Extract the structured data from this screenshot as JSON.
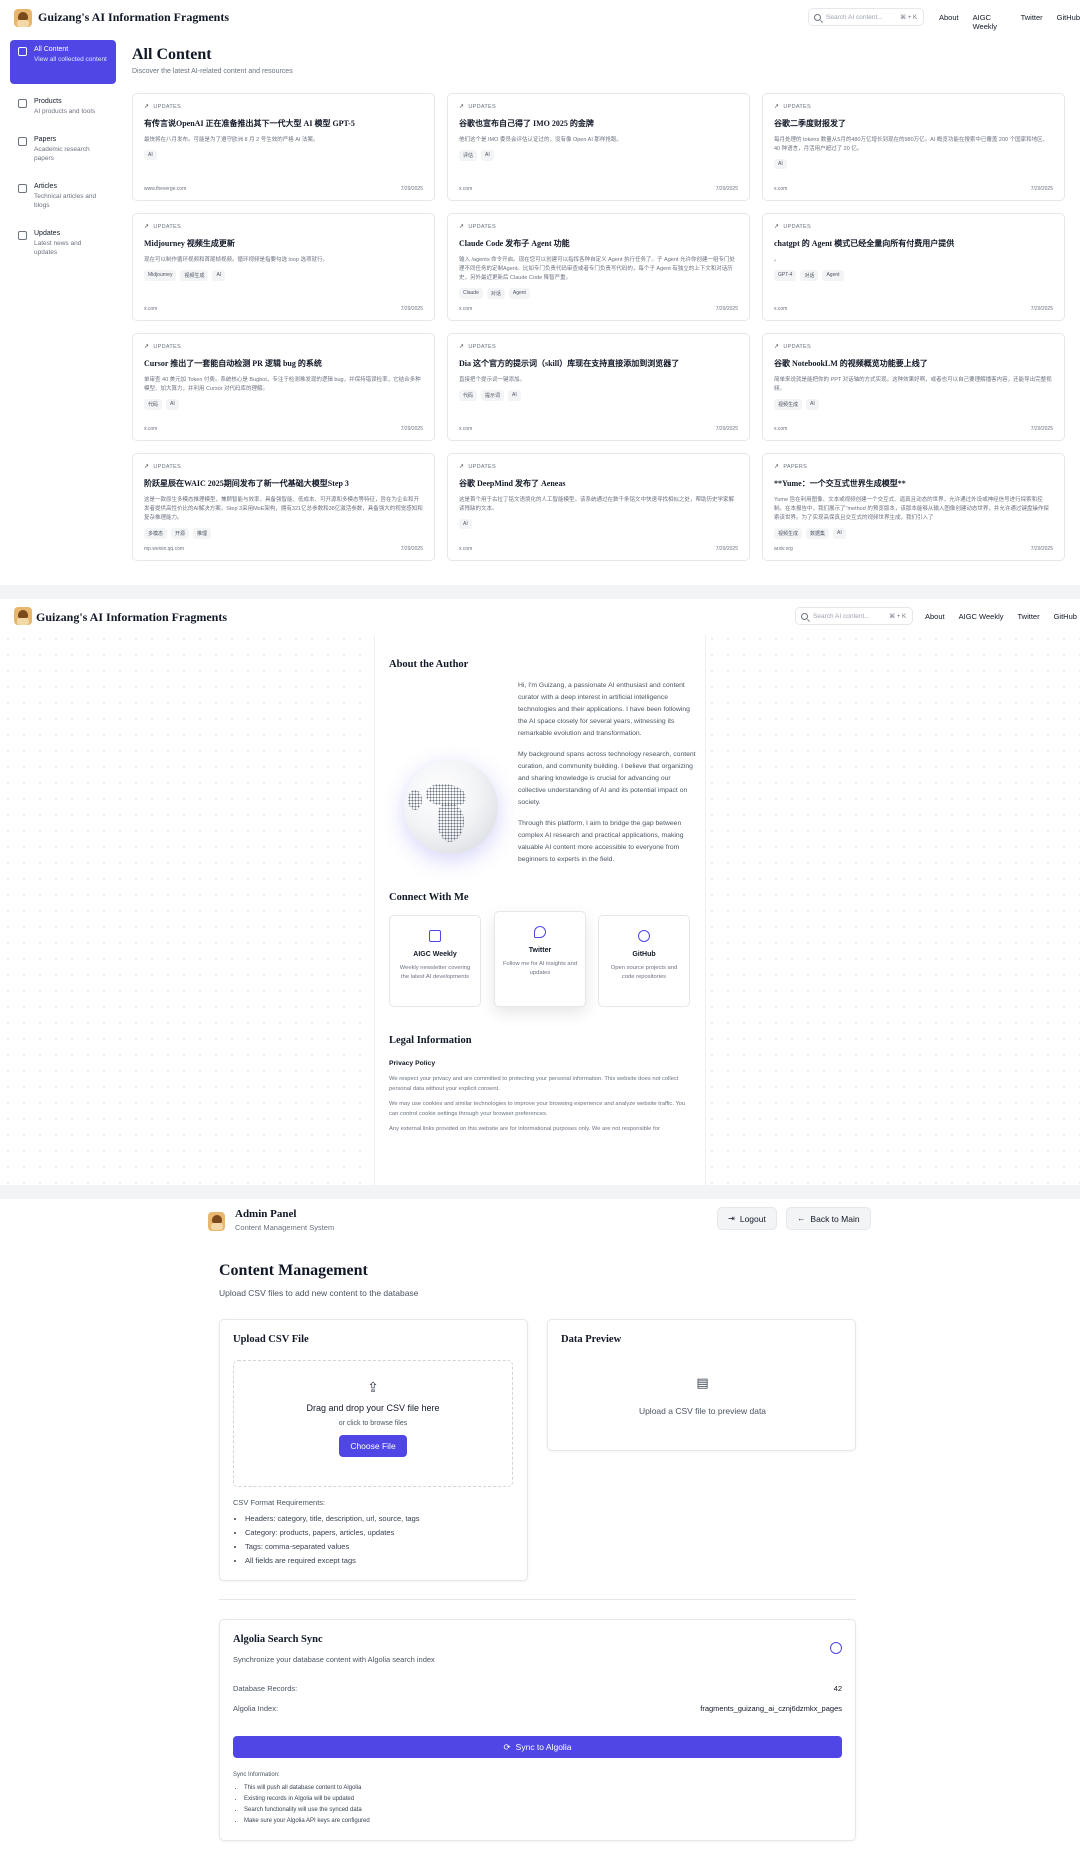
{
  "site": {
    "title": "Guizang's AI Information Fragments",
    "search_placeholder": "Search AI content...",
    "search_shortcut": "⌘ + K",
    "nav": [
      "About",
      "AIGC Weekly",
      "Twitter",
      "GitHub"
    ]
  },
  "sidebar": {
    "items": [
      {
        "label": "All Content",
        "sub": "View all collected content",
        "icon": "grid-icon",
        "active": true
      },
      {
        "label": "Products",
        "sub": "AI products and tools",
        "icon": "cube-icon",
        "active": false
      },
      {
        "label": "Papers",
        "sub": "Academic research papers",
        "icon": "file-icon",
        "active": false
      },
      {
        "label": "Articles",
        "sub": "Technical articles and blogs",
        "icon": "book-icon",
        "active": false
      },
      {
        "label": "Updates",
        "sub": "Latest news and updates",
        "icon": "trend-icon",
        "active": false
      }
    ]
  },
  "content": {
    "title": "All Content",
    "subtitle": "Discover the latest AI-related content and resources",
    "cards": [
      {
        "category": "UPDATES",
        "title": "有传言说OpenAI 正在准备推出其下一代大型 AI 模型 GPT-5",
        "desc": "最快将在八月发布。可能是为了遵守欧洲 8 月 2 号生效的严格 AI 法案。",
        "tags": [
          "AI"
        ],
        "source": "www.theverge.com",
        "date": "7/29/2025"
      },
      {
        "category": "UPDATES",
        "title": "谷歌也宣布自己得了 IMO 2025 的金牌",
        "desc": "他们这个是 IMO 委员会评估认证过的，没有像 Open AI 那样抢跑。",
        "tags": [
          "评估",
          "AI"
        ],
        "source": "x.com",
        "date": "7/29/2025"
      },
      {
        "category": "UPDATES",
        "title": "谷歌二季度财报发了",
        "desc": "每月处理的 tokens 数量从5月的480万亿增长到现在的980万亿。AI 概览功能在搜索中已覆盖 200 个国家和地区、40 种语言，月活用户超过了 20 亿。",
        "tags": [
          "AI"
        ],
        "source": "x.com",
        "date": "7/29/2025"
      },
      {
        "category": "UPDATES",
        "title": "Midjourney 视频生成更新",
        "desc": "现在可以制作循环视频和首尾帧视频。循环视频是指要勾选 loop 选项就行。",
        "tags": [
          "Midjourney",
          "视频生成",
          "AI"
        ],
        "source": "x.com",
        "date": "7/29/2025"
      },
      {
        "category": "UPDATES",
        "title": "Claude Code 发布子 Agent 功能",
        "desc": "输入 /agents 命令开启。现在您可以创建可以指挥各种自定义 Agent 执行任务了。子 Agent 允许你创建一组专门处理不同任务的定制Agent。比如专门负责代码审查或者专门负责写代码的，每个子 Agent 有独立的上下文和对话历史，另外最近更新后 Claude Code 降智严重。",
        "tags": [
          "Claude",
          "对话",
          "Agent"
        ],
        "source": "x.com",
        "date": "7/29/2025"
      },
      {
        "category": "UPDATES",
        "title": "chatgpt 的 Agent 模式已经全量向所有付费用户提供",
        "desc": "。",
        "tags": [
          "GPT-4",
          "对话",
          "Agent"
        ],
        "source": "x.com",
        "date": "7/29/2025"
      },
      {
        "category": "UPDATES",
        "title": "Cursor 推出了一套能自动检测 PR 逻辑 bug 的系统",
        "desc": "单审查 40 美元加 Token 付费。系统核心是 Bugbot，专注于检测难发现的逻辑 bug，并保持错误检率，它结合多种模型、加大算力，并利用 Cursor 对代码库的理解。",
        "tags": [
          "代码",
          "AI"
        ],
        "source": "x.com",
        "date": "7/29/2025"
      },
      {
        "category": "UPDATES",
        "title": "Dia 这个官方的提示词（skill）库现在支持直接添加到浏览器了",
        "desc": "直接把个提示词一键添加。",
        "tags": [
          "代码",
          "提示词",
          "AI"
        ],
        "source": "x.com",
        "date": "7/29/2025"
      },
      {
        "category": "UPDATES",
        "title": "谷歌 NotebookLM 的视频概览功能要上线了",
        "desc": "简单来说就是能把你的 PPT 对话轴的方式实现。这种效果好啊，或者也可以自己要理解播客内容，还能导出完整视频。",
        "tags": [
          "视频生成",
          "AI"
        ],
        "source": "x.com",
        "date": "7/29/2025"
      },
      {
        "category": "UPDATES",
        "title": "阶跃星辰在WAIC 2025期间发布了新一代基础大模型Step 3",
        "desc": "这是一款原生多模态推理模型，兼顾智能与效率，具备强智能、低成本、可开源和多模态等特征，旨在为企业和开发者提供高性价比的AI解决方案。Step 3采用MoE架构，拥有321亿总参数和38亿激活参数，具备强大的视觉感知和复杂推理能力。",
        "tags": [
          "多模态",
          "开源",
          "推理"
        ],
        "source": "mp.weixin.qq.com",
        "date": "7/29/2025"
      },
      {
        "category": "UPDATES",
        "title": "谷歌 DeepMind 发布了 Aeneas",
        "desc": "这是首个用于古拉丁铭文语境化的人工智能模型。该系统通过在数千条铭文中快速寻找相似之处，帮助历史学家解读残缺的文本。",
        "tags": [
          "AI"
        ],
        "source": "x.com",
        "date": "7/29/2025"
      },
      {
        "category": "PAPERS",
        "title": "**Yume：一个交互式世界生成模型**",
        "desc": "Yume 旨在利用图像、文本或视频创建一个交互式、逼真且动态的世界，允许通过外设或神经信号进行探索和控制。在本报告中，我们展示了\"method 的预览版本，该版本能够从输入图像创建动态世界，并允许通过键盘操作探索该世界。为了实现高保真且交互式的视频世界生成，我们引入了",
        "tags": [
          "视频生成",
          "数据集",
          "AI"
        ],
        "source": "arxiv.org",
        "date": "7/29/2025"
      }
    ]
  },
  "about": {
    "heading": "About the Author",
    "paragraphs": [
      "Hi, I'm Guizang, a passionate AI enthusiast and content curator with a deep interest in artificial intelligence technologies and their applications. I have been following the AI space closely for several years, witnessing its remarkable evolution and transformation.",
      "My background spans across technology research, content curation, and community building. I believe that organizing and sharing knowledge is crucial for advancing our collective understanding of AI and its potential impact on society.",
      "Through this platform, I aim to bridge the gap between complex AI research and practical applications, making valuable AI content more accessible to everyone from beginners to experts in the field."
    ],
    "connect_heading": "Connect With Me",
    "connect": [
      {
        "name": "AIGC Weekly",
        "desc": "Weekly newsletter covering the latest AI developments",
        "icon": "calendar-icon"
      },
      {
        "name": "Twitter",
        "desc": "Follow me for AI insights and updates",
        "icon": "twitter-icon"
      },
      {
        "name": "GitHub",
        "desc": "Open source projects and code repositories",
        "icon": "github-icon"
      }
    ],
    "legal_heading": "Legal Information",
    "privacy_heading": "Privacy Policy",
    "legal_paragraphs": [
      "We respect your privacy and are committed to protecting your personal information. This website does not collect personal data without your explicit consent.",
      "We may use cookies and similar technologies to improve your browsing experience and analyze website traffic. You can control cookie settings through your browser preferences.",
      "Any external links provided on this website are for informational purposes only. We are not responsible for"
    ]
  },
  "admin": {
    "title": "Admin Panel",
    "subtitle": "Content Management System",
    "logout": "Logout",
    "back": "Back to Main",
    "cm_title": "Content Management",
    "cm_subtitle": "Upload CSV files to add new content to the database",
    "upload_title": "Upload CSV File",
    "drop_text": "Drag and drop your CSV file here",
    "browse_text": "or click to browse files",
    "choose_btn": "Choose File",
    "req_title": "CSV Format Requirements:",
    "requirements": [
      "Headers: category, title, description, url, source, tags",
      "Category: products, papers, articles, updates",
      "Tags: comma-separated values",
      "All fields are required except tags"
    ],
    "preview_title": "Data Preview",
    "preview_text": "Upload a CSV file to preview data",
    "algolia_title": "Algolia Search Sync",
    "algolia_sub": "Synchronize your database content with Algolia search index",
    "db_label": "Database Records:",
    "db_value": "42",
    "index_label": "Algolia Index:",
    "index_value": "fragments_guizang_ai_cznj6dzmkx_pages",
    "sync_btn": "Sync to Algolia",
    "sync_info_title": "Sync Information:",
    "sync_info": [
      "This will push all database content to Algolia",
      "Existing records in Algolia will be updated",
      "Search functionality will use the synced data",
      "Make sure your Algolia API keys are configured"
    ]
  },
  "colors": {
    "accent": "#4f46e5",
    "text": "#111827",
    "muted": "#6b7280",
    "border": "#e5e7eb"
  }
}
